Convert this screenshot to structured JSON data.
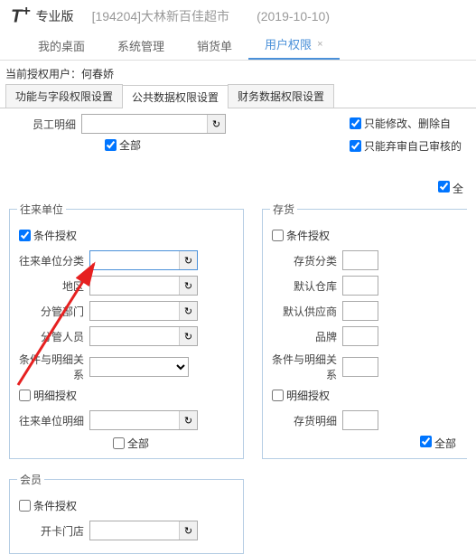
{
  "header": {
    "logo": "T",
    "logo_sup": "+",
    "edition": "专业版",
    "company": "[194204]大林新百佳超市",
    "date": "(2019-10-10)"
  },
  "tabs": {
    "items": [
      {
        "label": "我的桌面"
      },
      {
        "label": "系统管理"
      },
      {
        "label": "销货单"
      },
      {
        "label": "用户权限"
      }
    ],
    "close": "×"
  },
  "userinfo": "当前授权用户：何春娇",
  "subtabs": {
    "items": [
      {
        "label": "功能与字段权限设置"
      },
      {
        "label": "公共数据权限设置"
      },
      {
        "label": "财务数据权限设置"
      }
    ]
  },
  "topright": {
    "opt1": "只能修改、删除自",
    "opt2": "只能弃审自己审核的"
  },
  "emp": {
    "label": "员工明细",
    "all": "全部"
  },
  "topright2": {
    "all": "全"
  },
  "partner": {
    "legend": "往来单位",
    "cond_auth": "条件授权",
    "fields": {
      "cat": "往来单位分类",
      "region": "地区",
      "dept": "分管部门",
      "person": "分管人员",
      "rel": "条件与明细关系"
    },
    "detail_auth": "明细授权",
    "detail_field": "往来单位明细",
    "all": "全部"
  },
  "stock": {
    "legend": "存货",
    "cond_auth": "条件授权",
    "fields": {
      "cat": "存货分类",
      "wh": "默认仓库",
      "supplier": "默认供应商",
      "brand": "品牌",
      "rel": "条件与明细关系"
    },
    "detail_auth": "明细授权",
    "detail_field": "存货明细",
    "all": "全部"
  },
  "member": {
    "legend": "会员",
    "cond_auth": "条件授权",
    "fields": {
      "shop": "开卡门店"
    }
  },
  "icons": {
    "ref": "↻"
  }
}
